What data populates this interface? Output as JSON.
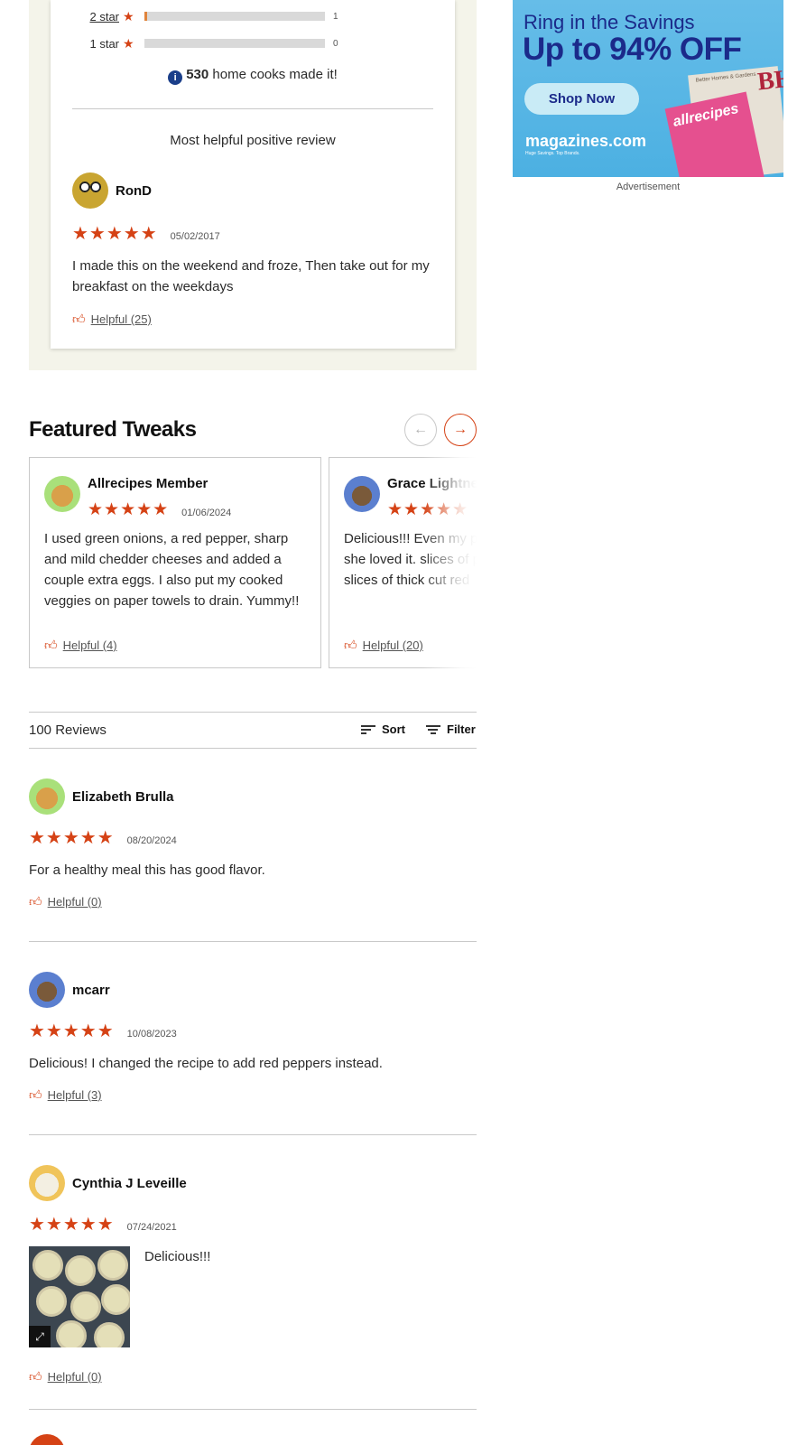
{
  "rating_summary": {
    "distribution": [
      {
        "label": "2 star",
        "count": "1",
        "fraction": 0.01,
        "is_link": true
      },
      {
        "label": "1 star",
        "count": "0",
        "fraction": 0.0,
        "is_link": false
      }
    ],
    "made_it_count": "530",
    "made_it_text": " home cooks made it!",
    "most_helpful_title": "Most helpful positive review",
    "most_helpful_review": {
      "user": "RonD",
      "avatar_icon": "owl-avatar-icon",
      "stars": "★★★★★",
      "date": "05/02/2017",
      "text": "I made this on the weekend and froze, Then take out for my breakfast on the weekdays",
      "helpful": "Helpful (25)"
    }
  },
  "advertisement": {
    "line1": "Ring in the Savings",
    "line2": "Up to 94% OFF",
    "button": "Shop Now",
    "logo": "magazines.com",
    "tagline": "Huge Savings. Top Brands.",
    "mag1_title": "Better Homes & Gardens",
    "mag1_brand": "BH",
    "mag2_title": "allrecipes",
    "label": "Advertisement"
  },
  "featured_tweaks": {
    "title": "Featured Tweaks",
    "prev_icon": "arrow-left-icon",
    "next_icon": "arrow-right-icon",
    "cards": [
      {
        "user": "Allrecipes Member",
        "stars": "★★★★★",
        "date": "01/06/2024",
        "text": "I used green onions, a red pepper, sharp and mild chedder cheeses and added a couple extra eggs. I also put my cooked veggies on paper towels to drain. Yummy!!",
        "helpful": "Helpful (4)"
      },
      {
        "user": "Grace Lightner",
        "stars": "★★★★★",
        "date": "",
        "text": "Delicious!!! Even my picky Daughter said she loved it. slices of pre cooked turkey 4 slices of thick cut red",
        "helpful": "Helpful (20)"
      }
    ]
  },
  "reviews_bar": {
    "count": "100 Reviews",
    "sort": "Sort",
    "filter": "Filter"
  },
  "reviews": [
    {
      "user": "Elizabeth Brulla",
      "stars": "★★★★★",
      "date": "08/20/2024",
      "text": "For a healthy meal this has good flavor.",
      "helpful": "Helpful (0)"
    },
    {
      "user": "mcarr",
      "stars": "★★★★★",
      "date": "10/08/2023",
      "text": "Delicious! I changed the recipe to add red peppers instead.",
      "helpful": "Helpful (3)"
    },
    {
      "user": "Cynthia J Leveille",
      "stars": "★★★★★",
      "date": "07/24/2021",
      "text": "Delicious!!!",
      "helpful": "Helpful (0)"
    }
  ],
  "colors": {
    "accent": "#d54215",
    "panel_bg": "#f4f4ea",
    "ad_blue": "#4cb0e2",
    "ad_navy": "#1b2a8a"
  }
}
